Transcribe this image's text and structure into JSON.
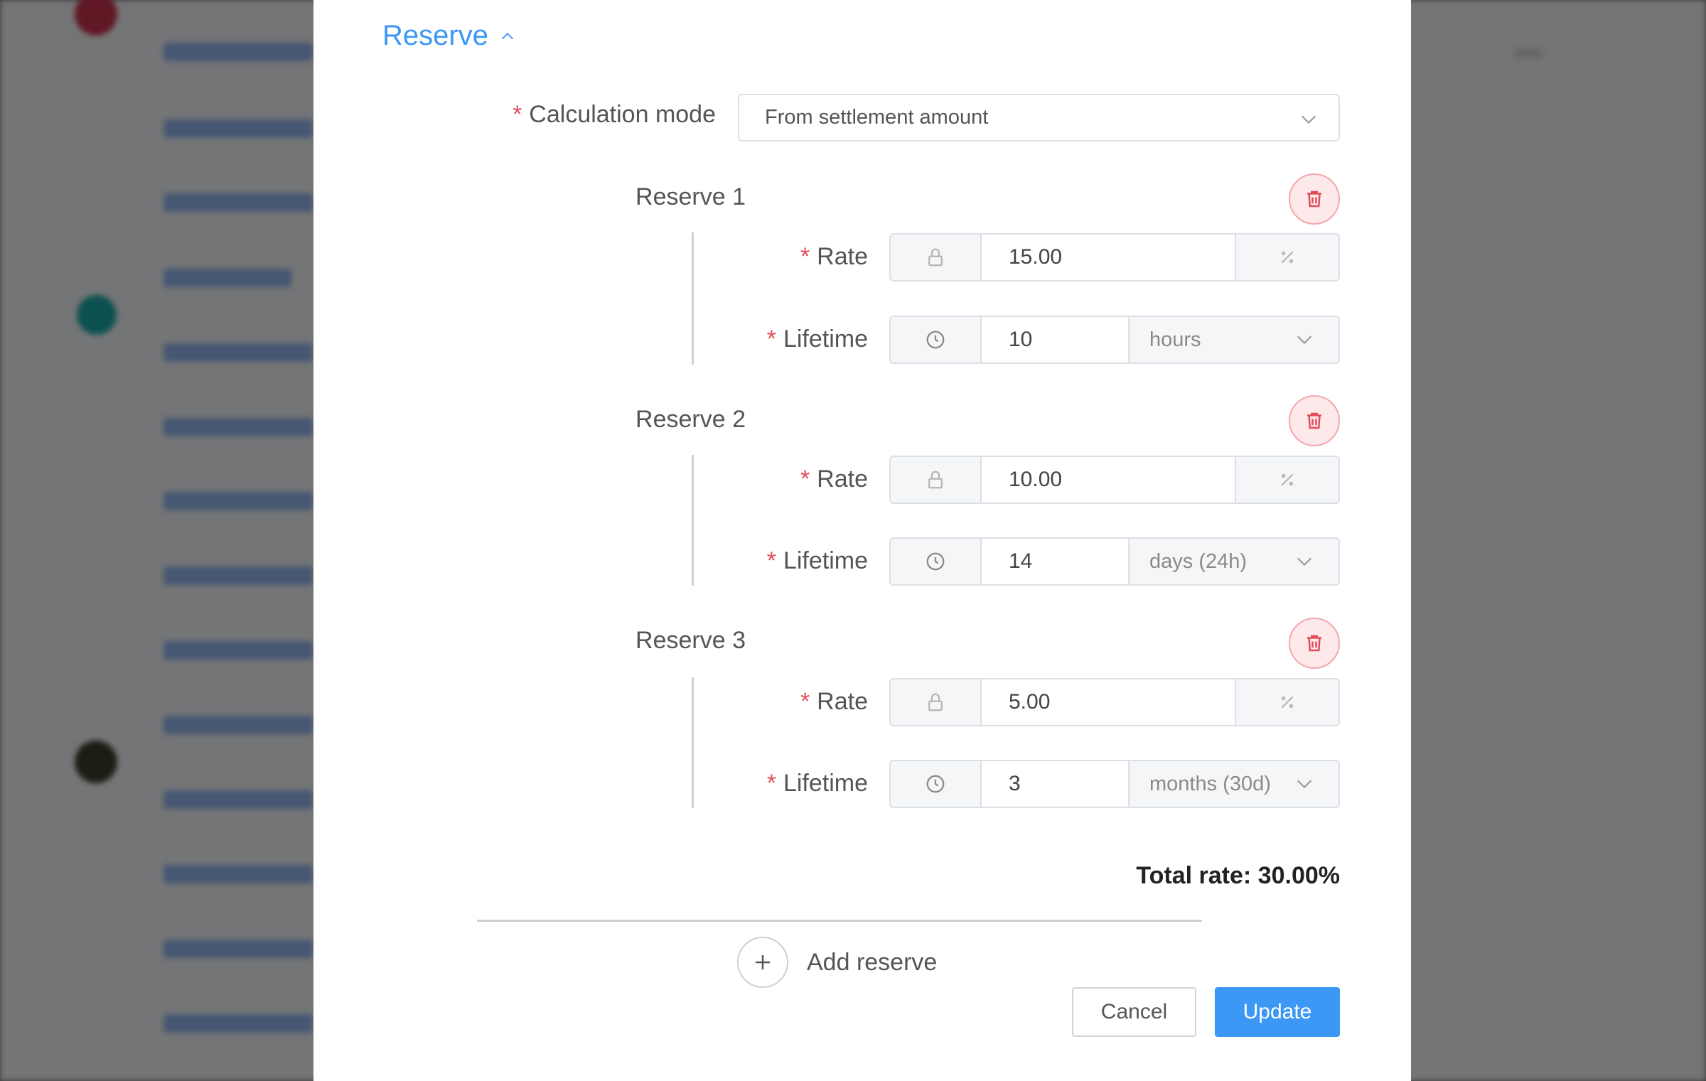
{
  "section": {
    "title": "Reserve"
  },
  "calculation": {
    "label": "Calculation mode",
    "value": "From settlement amount"
  },
  "reserves": [
    {
      "title": "Reserve 1",
      "rate_label": "Rate",
      "rate": "15.00",
      "lifetime_label": "Lifetime",
      "lifetime": "10",
      "unit": "hours"
    },
    {
      "title": "Reserve 2",
      "rate_label": "Rate",
      "rate": "10.00",
      "lifetime_label": "Lifetime",
      "lifetime": "14",
      "unit": "days (24h)"
    },
    {
      "title": "Reserve 3",
      "rate_label": "Rate",
      "rate": "5.00",
      "lifetime_label": "Lifetime",
      "lifetime": "3",
      "unit": "months (30d)"
    }
  ],
  "total": {
    "text": "Total rate: 30.00%"
  },
  "add": {
    "label": "Add reserve"
  },
  "actions": {
    "cancel": "Cancel",
    "update": "Update"
  },
  "colors": {
    "accent": "#3d97f5",
    "danger": "#e34d59",
    "danger_bg": "#fde8ea"
  }
}
